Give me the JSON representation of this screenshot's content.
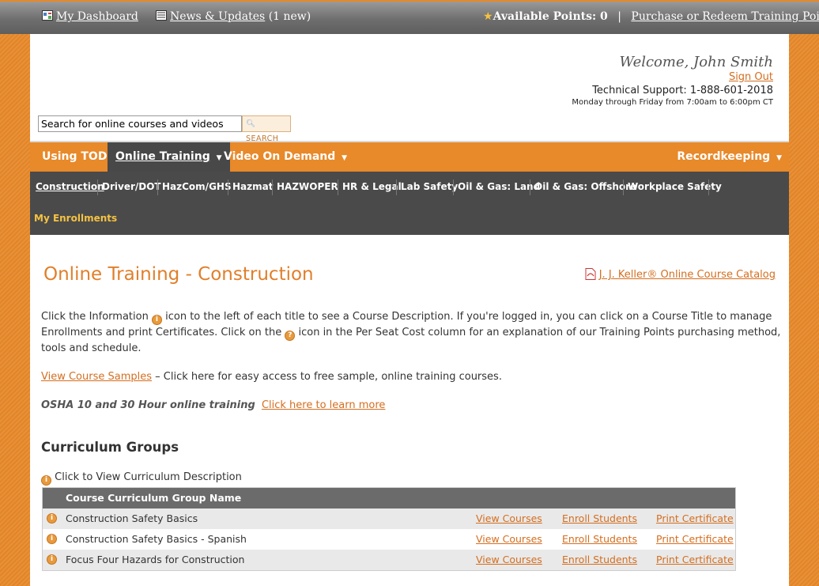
{
  "topbar": {
    "dashboard": "My Dashboard",
    "news": "News & Updates",
    "news_count": "(1 new)",
    "points": "Available Points: 0",
    "separator": "|",
    "purchase": "Purchase or Redeem Training Points"
  },
  "header": {
    "welcome": "Welcome, John Smith",
    "signout": "Sign Out",
    "support": "Technical Support: 1-888-601-2018",
    "hours": "Monday through Friday from 7:00am to 6:00pm CT"
  },
  "search": {
    "value": "Search for online courses and videos",
    "button": "SEARCH"
  },
  "mainnav": {
    "using": "Using TOD",
    "online": "Online Training",
    "video": "Video On Demand",
    "record": "Recordkeeping",
    "caret": "▼"
  },
  "subnav": {
    "items": [
      "Construction",
      "Driver/DOT",
      "HazCom/GHS",
      "Hazmat",
      "HAZWOPER",
      "HR & Legal",
      "Lab Safety",
      "Oil & Gas: Land",
      "Oil & Gas: Offshore",
      "Workplace Safety"
    ],
    "enrollments": "My Enrollments"
  },
  "content": {
    "title": "Online Training - Construction",
    "catalog": "J. J. Keller® Online Course Catalog",
    "intro_1": "Click the Information",
    "intro_2": "icon to the left of each title to see a Course Description. If you're logged in, you can click on a Course Title to manage",
    "intro_3": "Enrollments and print Certificates. Click on the",
    "intro_4": "icon in the Per Seat Cost column for an explanation of our Training Points purchasing method,",
    "intro_5": "tools and schedule.",
    "samples_link": "View Course Samples",
    "samples_text": " – Click here for easy access to free sample, online training courses.",
    "osha_text": "OSHA 10 and 30 Hour online training",
    "osha_link": "Click here to learn more",
    "groups_heading": "Curriculum Groups",
    "click_desc": "Click to View Curriculum Description"
  },
  "table": {
    "header": "Course Curriculum Group Name",
    "rows": [
      {
        "name": "Construction Safety Basics",
        "view": "View Courses",
        "enroll": "Enroll Students",
        "print": "Print Certificate"
      },
      {
        "name": "Construction Safety Basics - Spanish",
        "view": "View Courses",
        "enroll": "Enroll Students",
        "print": "Print Certificate"
      },
      {
        "name": "Focus Four Hazards for Construction",
        "view": "View Courses",
        "enroll": "Enroll Students",
        "print": "Print Certificate"
      }
    ]
  },
  "icons": {
    "info": "i",
    "help": "?"
  },
  "colors": {
    "accent": "#e8892a",
    "link": "#d46e1f",
    "nav_dark": "#4a4a4a",
    "enroll_yellow": "#f5c242"
  }
}
